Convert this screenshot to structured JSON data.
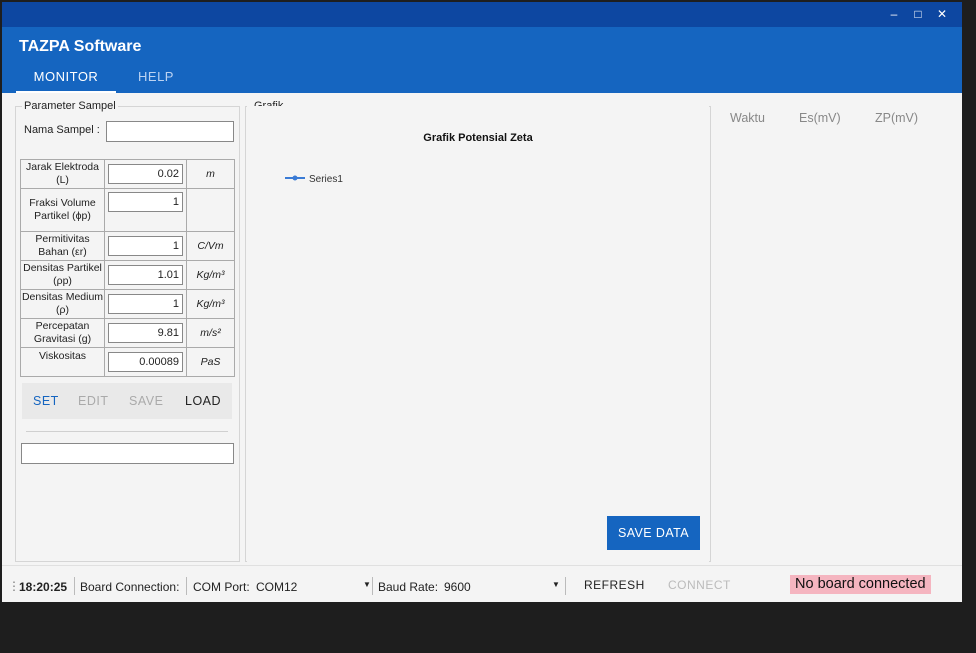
{
  "window": {
    "title": "TAZPA Software",
    "controls": {
      "minimize": "–",
      "maximize": "□",
      "close": "✕"
    }
  },
  "tabs": [
    {
      "label": "MONITOR",
      "active": true
    },
    {
      "label": "HELP",
      "active": false
    }
  ],
  "params_panel": {
    "title": "Parameter Sampel",
    "sample_name_label": "Nama Sampel :",
    "sample_name_value": "",
    "rows": [
      {
        "label": "Jarak Elektroda (L)",
        "value": "0.02",
        "unit": "m"
      },
      {
        "label": "Fraksi Volume Partikel (ϕp)",
        "value": "1",
        "unit": ""
      },
      {
        "label": "Permitivitas Bahan (εr)",
        "value": "1",
        "unit": "C/Vm"
      },
      {
        "label": "Densitas Partikel (ρp)",
        "value": "1.01",
        "unit": "Kg/m³"
      },
      {
        "label": "Densitas Medium (ρ)",
        "value": "1",
        "unit": "Kg/m³"
      },
      {
        "label": "Percepatan Gravitasi (g)",
        "value": "9.81",
        "unit": "m/s²"
      },
      {
        "label": "Viskositas",
        "value": "0.00089",
        "unit": "PaS"
      }
    ],
    "buttons": {
      "set": "SET",
      "edit": "EDIT",
      "save": "SAVE",
      "load": "LOAD"
    },
    "status_value": ""
  },
  "chart_panel": {
    "group_title": "Grafik",
    "chart_title": "Grafik Potensial Zeta",
    "legend": "Series1",
    "save_button": "SAVE DATA"
  },
  "chart_data": {
    "type": "line",
    "title": "Grafik Potensial Zeta",
    "series": [
      {
        "name": "Series1",
        "values": []
      }
    ]
  },
  "data_table": {
    "headers": [
      "Waktu",
      "Es(mV)",
      "ZP(mV)"
    ]
  },
  "statusbar": {
    "time": "18:20:25",
    "board_label": "Board Connection:",
    "com_label": "COM Port:",
    "com_value": "COM12",
    "baud_label": "Baud Rate:",
    "baud_value": "9600",
    "refresh": "REFRESH",
    "connect": "CONNECT",
    "status_text": "No board connected"
  },
  "colors": {
    "titlebar": "#0d47a1",
    "header": "#1565c0",
    "accent": "#1565c0",
    "alert_bg": "#f5b5c0"
  }
}
